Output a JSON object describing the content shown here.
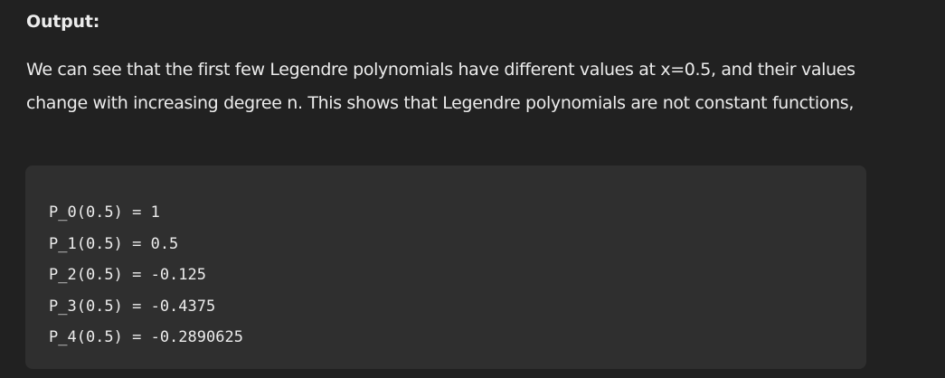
{
  "heading": "Output:",
  "paragraph": "We can see that the first few Legendre polynomials have different values at x=0.5, and their values change with increasing degree n. This shows that Legendre polynomials are not constant functions,",
  "code_lines": [
    "P_0(0.5) = 1",
    "P_1(0.5) = 0.5",
    "P_2(0.5) = -0.125",
    "P_3(0.5) = -0.4375",
    "P_4(0.5) = -0.2890625"
  ]
}
